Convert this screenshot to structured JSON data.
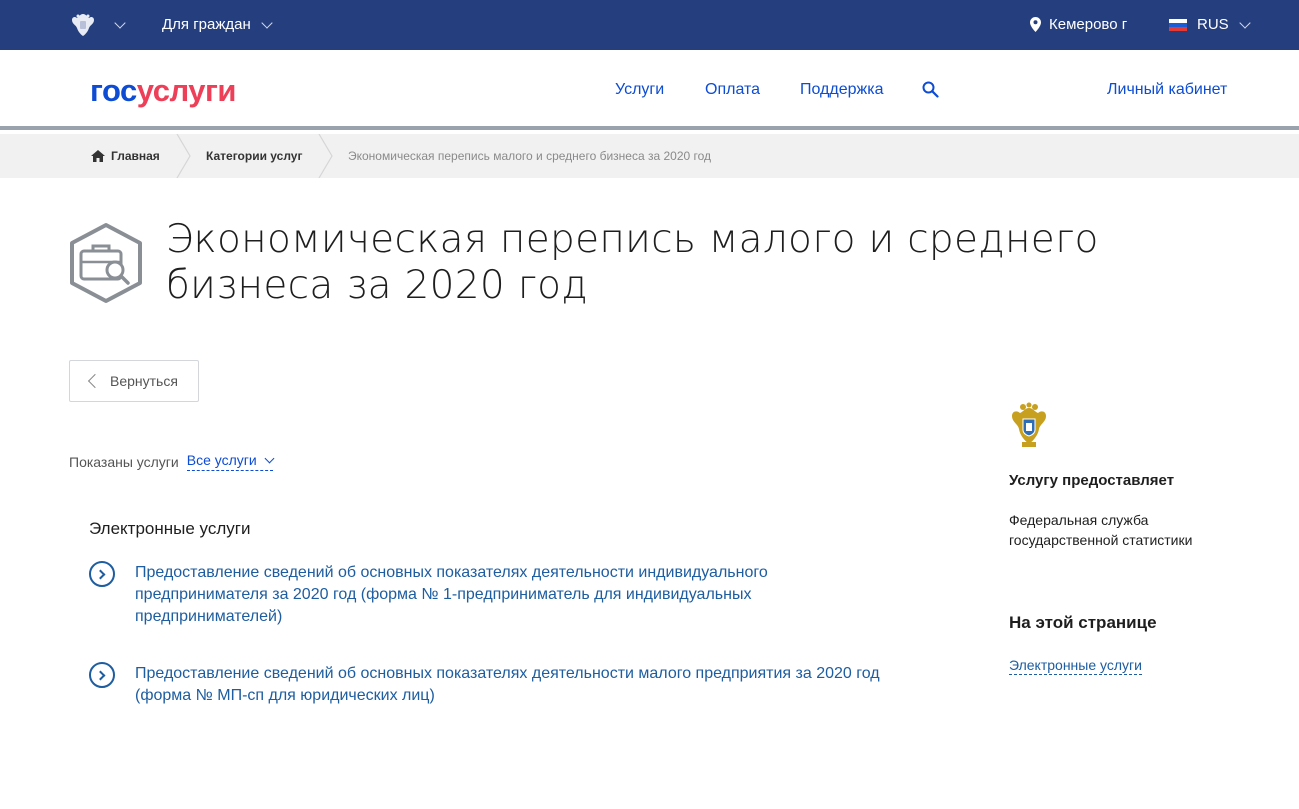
{
  "topbar": {
    "for_citizens": "Для граждан",
    "city": "Кемерово г",
    "lang": "RUS",
    "bg_color": "#253f7e"
  },
  "header": {
    "logo_part1": "гос",
    "logo_part2": "услуги",
    "nav": [
      "Услуги",
      "Оплата",
      "Поддержка"
    ],
    "cabinet": "Личный кабинет"
  },
  "breadcrumb": {
    "home": "Главная",
    "categories": "Категории услуг",
    "current": "Экономическая перепись малого и среднего бизнеса за 2020 год"
  },
  "page": {
    "title": "Экономическая перепись малого и среднего бизнеса за 2020 год",
    "back": "Вернуться",
    "filter_label": "Показаны услуги",
    "filter_value": "Все услуги",
    "section": "Электронные услуги",
    "services": [
      "Предоставление сведений об основных показателях деятельности индивидуального предпринимателя за 2020 год (форма № 1-предприниматель для индивидуальных предпринимателей)",
      "Предоставление сведений об основных показателях деятельности малого предприятия за 2020 год (форма № МП-сп для юридических лиц)"
    ]
  },
  "sidebar": {
    "provider_heading": "Услугу предоставляет",
    "provider_name": "Федеральная служба государственной статистики",
    "onpage_heading": "На этой странице",
    "onpage_link": "Электронные услуги"
  },
  "colors": {
    "accent_blue": "#0d4cd3",
    "logo_red": "#ee3f58",
    "link_blue": "#1d5da0"
  }
}
